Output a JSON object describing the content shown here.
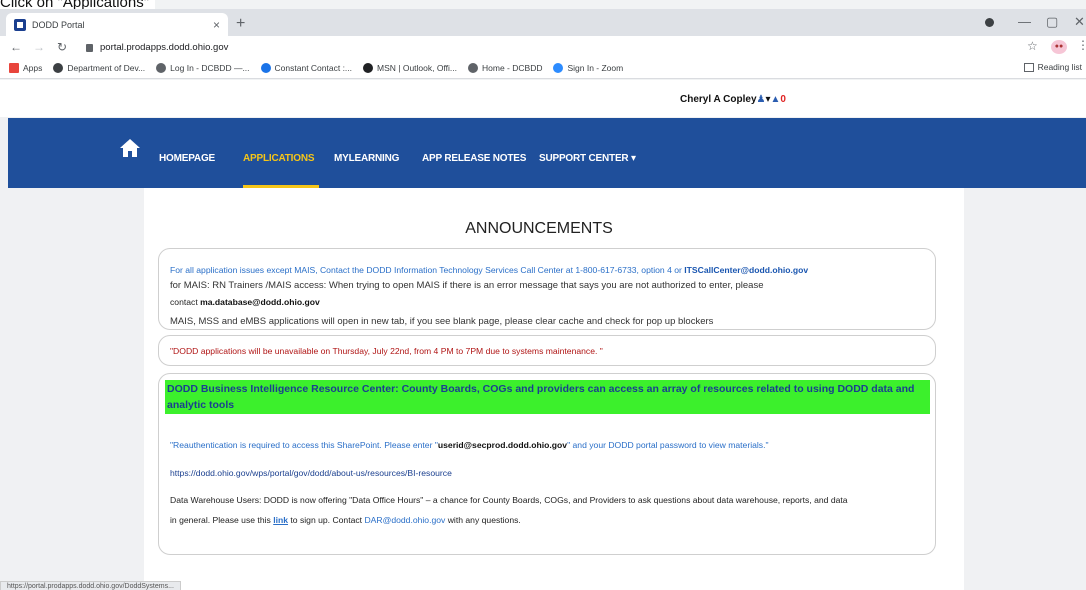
{
  "caption": "Click on \"Applications\"",
  "browser": {
    "tab_title": "DODD Portal",
    "tab_close": "×",
    "new_tab": "+",
    "url": "portal.prodapps.dodd.ohio.gov",
    "bookmarks": [
      {
        "label": "Apps",
        "color": "#e8453c"
      },
      {
        "label": "Department of Dev...",
        "color": "#3c4043"
      },
      {
        "label": "Log In - DCBDD —...",
        "color": "#5f6368"
      },
      {
        "label": "Constant Contact :...",
        "color": "#1a73e8"
      },
      {
        "label": "MSN | Outlook, Offi...",
        "color": "#202124"
      },
      {
        "label": "Home - DCBDD",
        "color": "#5f6368"
      },
      {
        "label": "Sign In - Zoom",
        "color": "#2d8cff"
      }
    ],
    "reading_list": "Reading list",
    "status_url": "https://portal.prodapps.dodd.ohio.gov/DoddSystems..."
  },
  "user": {
    "name": "Cheryl A Copley",
    "bell_count": "0"
  },
  "nav": {
    "items": [
      "HOMEPAGE",
      "APPLICATIONS",
      "MYLEARNING",
      "APP RELEASE NOTES",
      "SUPPORT CENTER ▾"
    ],
    "active": "APPLICATIONS"
  },
  "announcements": {
    "title": "ANNOUNCEMENTS",
    "box1": {
      "line1_prefix": "For all application issues except MAIS, Contact the DODD Information Technology Services Call Center at 1-800-617-6733, option 4 or ",
      "line1_email": "ITSCallCenter@dodd.ohio.gov",
      "line2": "for MAIS: RN Trainers /MAIS access:  When trying to open MAIS if there is an error message that says you are not authorized to enter, please",
      "line3_prefix": "contact ",
      "line3_email": "ma.database@dodd.ohio.gov",
      "line4": "MAIS, MSS and eMBS applications will open in new tab, if you see blank page, please clear cache and check for pop up blockers"
    },
    "box2": {
      "text": "\"DODD applications will be unavailable on Thursday, July 22nd,  from 4 PM to 7PM due to systems maintenance. \""
    },
    "box3": {
      "highlight": "DODD Business Intelligence Resource Center: County Boards, COGs and providers can access an array of resources related to using DODD data and analytic tools",
      "reauth_prefix": "\"Reauthentication is required to access this SharePoint. Please enter \"",
      "reauth_user": "userid@secprod.dodd.ohio.gov",
      "reauth_suffix": "\" and your DODD portal password to view materials.\"",
      "url": "https://dodd.ohio.gov/wps/portal/gov/dodd/about-us/resources/BI-resource",
      "dw_line1": "Data Warehouse Users: DODD is now offering \"Data Office Hours\" – a chance for County Boards, COGs, and Providers to ask questions about data warehouse, reports, and data",
      "dw_line2_prefix": "in general. Please use this ",
      "dw_link": "link",
      "dw_line2_mid": " to sign up. Contact ",
      "dw_email": "DAR@dodd.ohio.gov",
      "dw_line2_suffix": " with any questions."
    }
  }
}
